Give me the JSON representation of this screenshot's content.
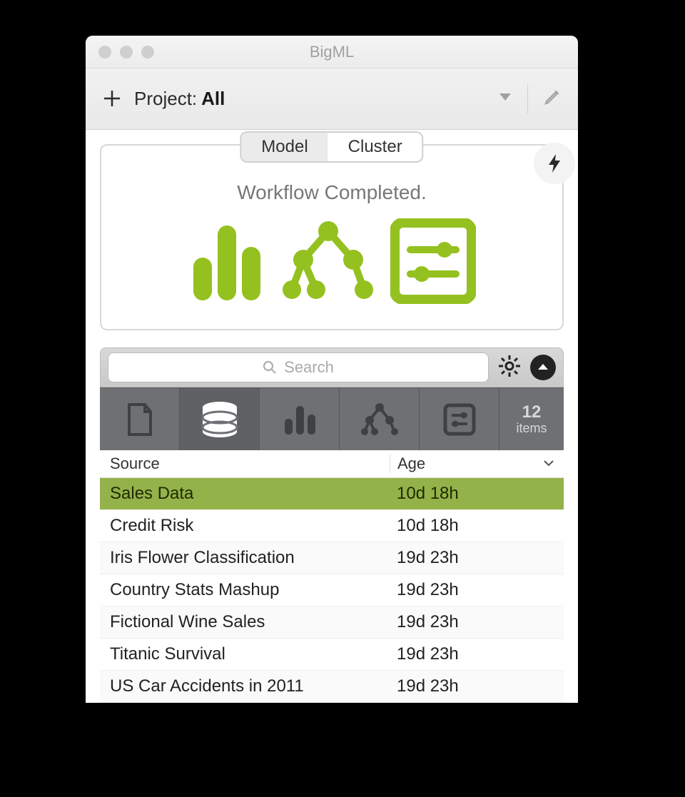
{
  "window": {
    "title": "BigML"
  },
  "toolbar": {
    "project_label": "Project:",
    "project_value": "All"
  },
  "workflow": {
    "tabs": [
      {
        "label": "Model",
        "active": true
      },
      {
        "label": "Cluster",
        "active": false
      }
    ],
    "status": "Workflow Completed."
  },
  "search": {
    "placeholder": "Search"
  },
  "category_tabs": {
    "count": "12",
    "count_label": "items"
  },
  "table": {
    "columns": {
      "source": "Source",
      "age": "Age"
    },
    "rows": [
      {
        "source": "Sales Data",
        "age": "10d 18h",
        "selected": true
      },
      {
        "source": "Credit Risk",
        "age": "10d 18h"
      },
      {
        "source": "Iris Flower Classification",
        "age": "19d 23h"
      },
      {
        "source": "Country Stats Mashup",
        "age": "19d 23h"
      },
      {
        "source": "Fictional Wine Sales",
        "age": "19d 23h"
      },
      {
        "source": "Titanic Survival",
        "age": "19d 23h"
      },
      {
        "source": "US Car Accidents in 2011",
        "age": "19d 23h"
      }
    ]
  }
}
